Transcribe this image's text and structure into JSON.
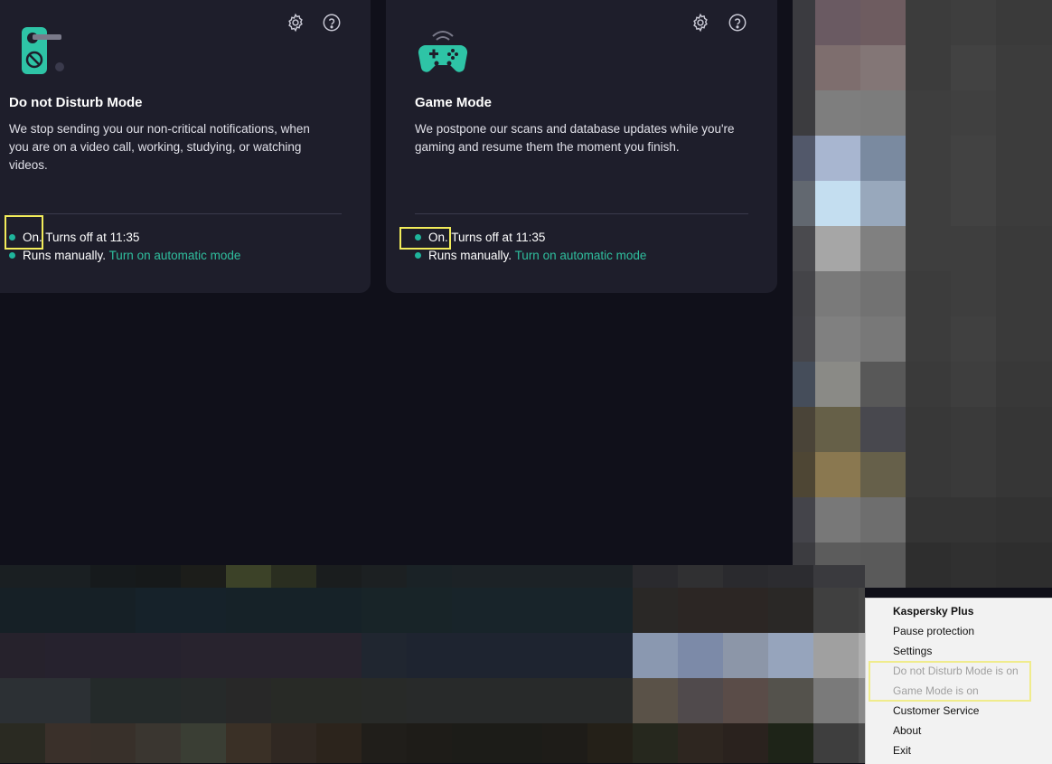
{
  "cards": [
    {
      "title": "Do not Disturb Mode",
      "description_lines": [
        "We stop sending you our non-critical notifications, when",
        "you are on a video call, working, studying, or watching",
        "videos."
      ],
      "status_on": "On.",
      "status_on_rest": "Turns off at 11:35",
      "status_manual": "Runs manually.",
      "status_link": "Turn on automatic mode"
    },
    {
      "title": "Game Mode",
      "description_lines": [
        "We postpone our scans and database updates while you're",
        "gaming and resume them the moment you finish."
      ],
      "status_on": "On.",
      "status_on_rest": "Turns off at 11:35",
      "status_manual": "Runs manually.",
      "status_link": "Turn on automatic mode"
    }
  ],
  "context_menu": {
    "items": [
      {
        "label": "Kaspersky Plus",
        "style": "bold"
      },
      {
        "label": "Pause protection",
        "style": "normal"
      },
      {
        "label": "Settings",
        "style": "normal"
      },
      {
        "label": "Do not Disturb Mode is on",
        "style": "disabled"
      },
      {
        "label": "Game Mode is on",
        "style": "disabled"
      },
      {
        "label": "Customer Service",
        "style": "normal"
      },
      {
        "label": "About",
        "style": "normal"
      },
      {
        "label": "Exit",
        "style": "normal"
      }
    ]
  },
  "icons": {
    "settings": "gear-icon",
    "help": "question-circle-icon",
    "dnd": "door-hanger-icon",
    "game": "gamepad-icon"
  },
  "colors": {
    "accent": "#2fbf9e",
    "status_dot": "#1fb59c",
    "highlight": "#f2ec5a",
    "card_bg": "#1e1e2b",
    "app_bg": "#10101a"
  }
}
